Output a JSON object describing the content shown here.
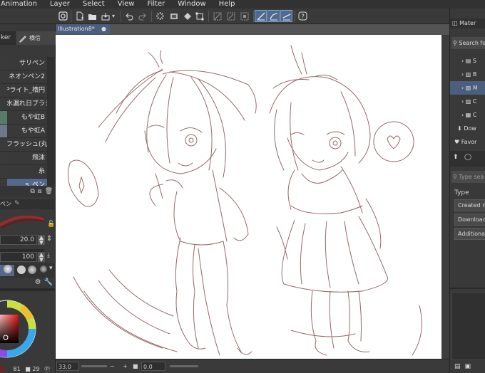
{
  "menu": [
    "Animation",
    "Layer",
    "Select",
    "View",
    "Filter",
    "Window",
    "Help"
  ],
  "canvas": {
    "tab_title": "Illustration8*",
    "tab_close": "●",
    "zoom": "33.0",
    "angle": "0.0"
  },
  "left_panel": {
    "panel_tab": "ker",
    "sub_tab": "横信",
    "brushes": [
      "サリペン",
      "ネオンペン2",
      "Pライト_楕円",
      "・水漏れ日ブラシ",
      "もや虹B",
      "もや虹A",
      "虹フラッシュ(丸)",
      "飛沫",
      "糸",
      "s_ペン"
    ],
    "selected_brush_index": 9,
    "prop_tab": "ペン",
    "brush_size": "20.0",
    "opacity": "100",
    "bottom_values": [
      "81",
      "29"
    ]
  },
  "right_panel": {
    "header": "Mater",
    "search": "Search fo",
    "tree": [
      "S",
      "B",
      "M",
      "C",
      "C",
      "Dow",
      "Favor"
    ],
    "selected_tree_index": 2,
    "search2_placeholder": "Type sea",
    "type_label": "Type",
    "type_buttons": [
      "Created ma",
      "Downloade",
      "Additional"
    ]
  },
  "colors": {
    "accent": "#52698d",
    "selection": "#4b5e7e",
    "sketch_stroke": "#8a5a5a"
  }
}
